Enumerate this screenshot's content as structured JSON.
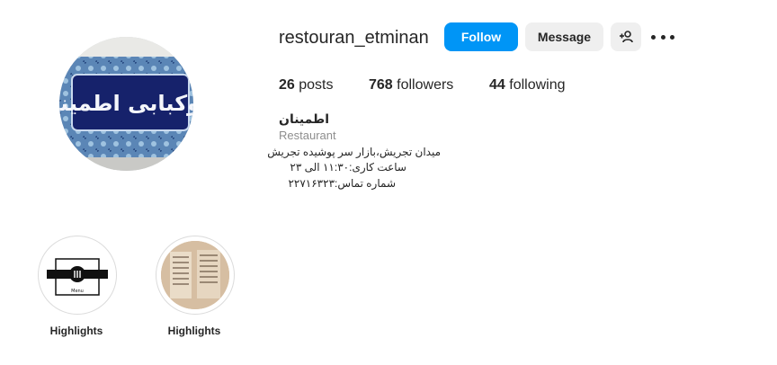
{
  "profile": {
    "username": "restouran_etminan",
    "follow_label": "Follow",
    "message_label": "Message",
    "adduser_icon": "add-user-icon",
    "more_icon": "more-icon",
    "avatar_text": "چلوکبابی اطمینان"
  },
  "stats": {
    "posts_count": "26",
    "posts_label": "posts",
    "followers_count": "768",
    "followers_label": "followers",
    "following_count": "44",
    "following_label": "following"
  },
  "bio": {
    "name": "اطمینان",
    "category": "Restaurant",
    "line1": "میدان تجریش،بازار سر پوشیده تجریش",
    "line2": "ساعت کاری:۱۱:۳۰ الی ۲۳",
    "line3": "شماره تماس:۲۲۷۱۶۳۲۳"
  },
  "highlights": [
    {
      "label": "Highlights",
      "cover_text": "Menu"
    },
    {
      "label": "Highlights"
    }
  ],
  "colors": {
    "accent": "#0095f6",
    "secondary_button": "#efefef",
    "muted_text": "#8e8e8e"
  }
}
